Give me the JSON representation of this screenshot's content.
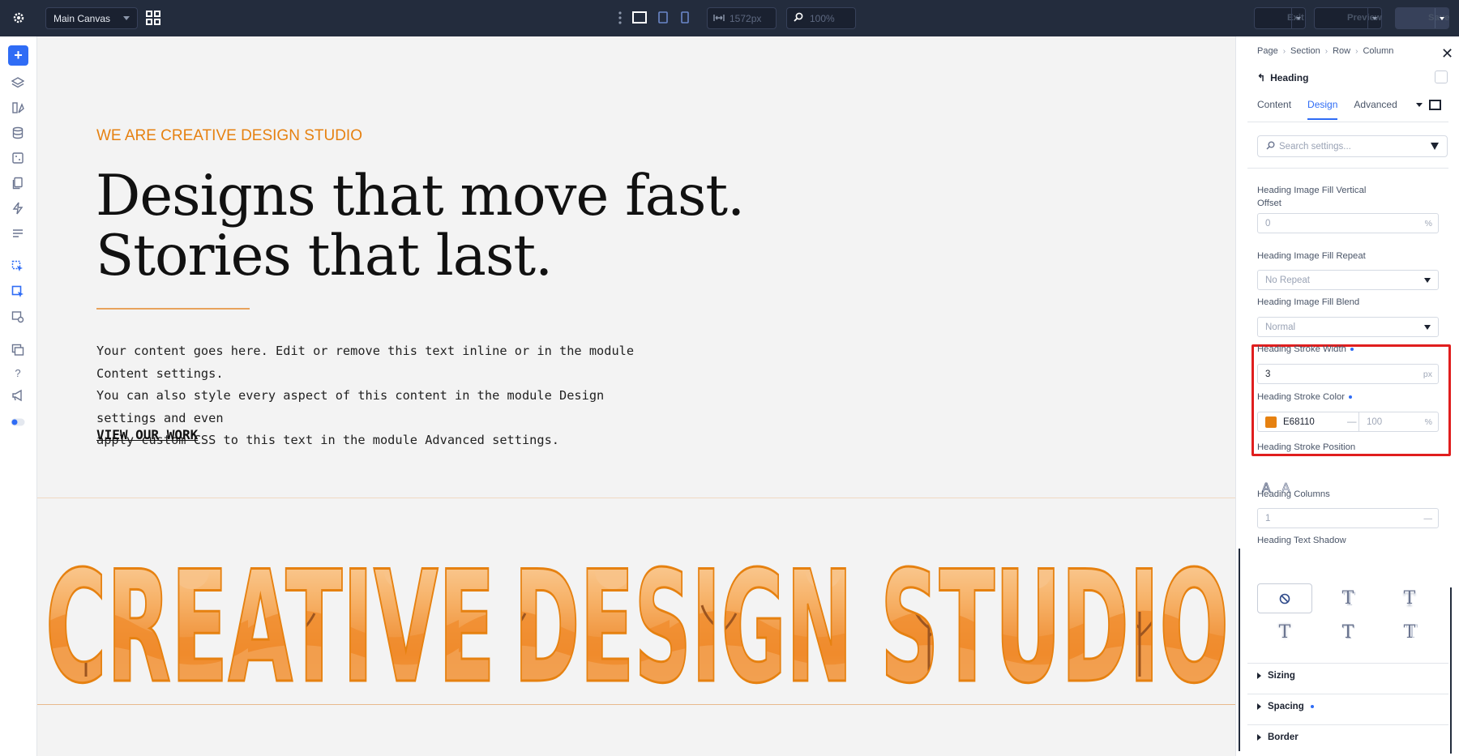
{
  "topbar": {
    "canvas_label": "Main Canvas",
    "width_value": "1572px",
    "zoom_value": "100%",
    "exit_label": "Exit",
    "preview_label": "Preview",
    "save_label": "Save"
  },
  "canvas": {
    "eyebrow": "WE ARE CREATIVE DESIGN STUDIO",
    "headline_line1": "Designs that move fast.",
    "headline_line2": "Stories that last.",
    "body_line1": "Your content goes here. Edit or remove this text inline or in the module Content settings.",
    "body_line2": "You can also style every aspect of this content in the module Design settings and even",
    "body_line3": "apply custom CSS to this text in the module Advanced settings.",
    "cta": "VIEW OUR WORK",
    "big_words": [
      "CREATIVE",
      "DESIGN",
      "STUDIO"
    ]
  },
  "panel": {
    "breadcrumb": [
      "Page",
      "Section",
      "Row",
      "Column"
    ],
    "element_title": "Heading",
    "tabs": [
      "Content",
      "Design",
      "Advanced"
    ],
    "active_tab": "Design",
    "search_placeholder": "Search settings...",
    "fill_vertical_offset": {
      "label_line1": "Heading Image Fill Vertical",
      "label_line2": "Offset",
      "value": "0",
      "unit": "%"
    },
    "fill_repeat": {
      "label": "Heading Image Fill Repeat",
      "value": "No Repeat"
    },
    "fill_blend": {
      "label": "Heading Image Fill Blend",
      "value": "Normal"
    },
    "stroke_width": {
      "label": "Heading Stroke Width",
      "value": "3",
      "unit": "px"
    },
    "stroke_color": {
      "label": "Heading Stroke Color",
      "hex": "E68110",
      "swatch": "#E68110",
      "opacity": "100",
      "unit": "%"
    },
    "stroke_position": {
      "label": "Heading Stroke Position"
    },
    "columns": {
      "label": "Heading Columns",
      "value": "1"
    },
    "text_shadow": {
      "label": "Heading Text Shadow"
    },
    "accordions": [
      "Sizing",
      "Spacing",
      "Border"
    ]
  },
  "colors": {
    "accent": "#2f6cf5",
    "brand_orange": "#e68110",
    "topbar_bg": "#232c3d",
    "highlight": "#e01e1e"
  }
}
